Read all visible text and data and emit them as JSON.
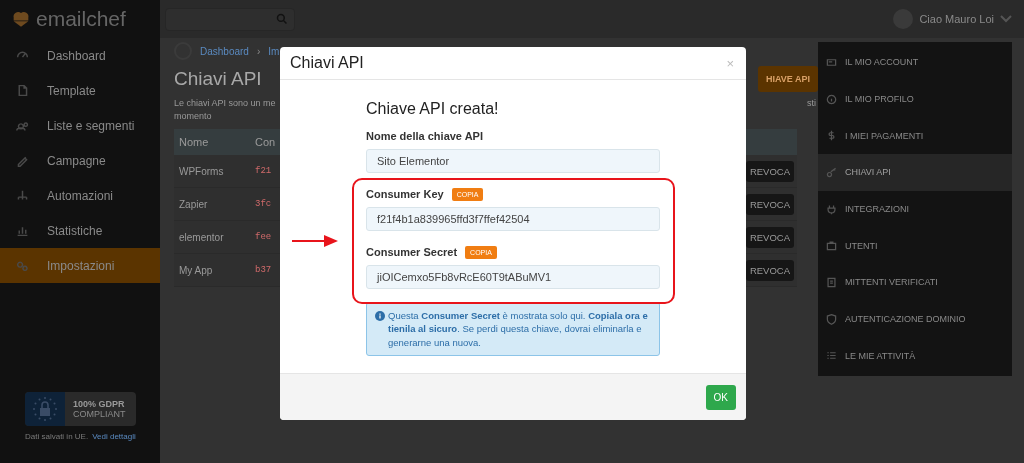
{
  "brand": {
    "name": "emailchef"
  },
  "sidebar": {
    "items": [
      {
        "label": "Dashboard",
        "selected": false
      },
      {
        "label": "Template",
        "selected": false
      },
      {
        "label": "Liste e segmenti",
        "selected": false
      },
      {
        "label": "Campagne",
        "selected": false
      },
      {
        "label": "Automazioni",
        "selected": false
      },
      {
        "label": "Statistiche",
        "selected": false
      },
      {
        "label": "Impostazioni",
        "selected": true
      }
    ],
    "gdpr": {
      "title": "100% GDPR",
      "subtitle": "COMPLIANT"
    },
    "footer_text": "Dati salvati in UE.",
    "footer_link": "Vedi dettagli"
  },
  "topbar": {
    "user": "Ciao Mauro Loi"
  },
  "breadcrumb": {
    "items": [
      "Dashboard",
      "Im"
    ],
    "separator": "›"
  },
  "annotation": {
    "highlight_box": true,
    "arrow": true
  },
  "page": {
    "title": "Chiavi API",
    "description": "Le chiavi API sono un me",
    "description_2": "momento",
    "new_button": "HIAVE API",
    "side_note": "sti"
  },
  "table": {
    "columns": [
      "Nome",
      "Con"
    ],
    "rows": [
      {
        "name": "WPForms",
        "key": "f21",
        "action": "REVOCA"
      },
      {
        "name": "Zapier",
        "key": "3fc",
        "action": "REVOCA"
      },
      {
        "name": "elementor",
        "key": "fee",
        "action": "REVOCA"
      },
      {
        "name": "My App",
        "key": "b37",
        "action": "REVOCA"
      }
    ]
  },
  "settings_menu": [
    {
      "label": "IL MIO ACCOUNT",
      "selected": false
    },
    {
      "label": "IL MIO PROFILO",
      "selected": false
    },
    {
      "label": "I MIEI PAGAMENTI",
      "selected": false
    },
    {
      "label": "CHIAVI API",
      "selected": true
    },
    {
      "label": "INTEGRAZIONI",
      "selected": false
    },
    {
      "label": "UTENTI",
      "selected": false
    },
    {
      "label": "MITTENTI VERIFICATI",
      "selected": false
    },
    {
      "label": "AUTENTICAZIONE DOMINIO",
      "selected": false
    },
    {
      "label": "LE MIE ATTIVITÀ",
      "selected": false
    }
  ],
  "modal": {
    "title": "Chiavi API",
    "close": "×",
    "heading": "Chiave API creata!",
    "fields": [
      {
        "label": "Nome della chiave API",
        "value": "Sito Elementor"
      },
      {
        "label": "Consumer Key",
        "value": "f21f4b1a839965ffd3f7ffef42504",
        "copy": "COPIA"
      },
      {
        "label": "Consumer Secret",
        "value": "jiOICemxo5Fb8vRcE60T9tABuMV1",
        "copy": "COPIA"
      }
    ],
    "info": "Questa **Consumer Secret** è mostrata solo qui. **Copiala ora e tienila al sicuro**. Se perdi questa chiave, dovrai eliminarla e generarne una nuova.",
    "ok": "OK"
  }
}
